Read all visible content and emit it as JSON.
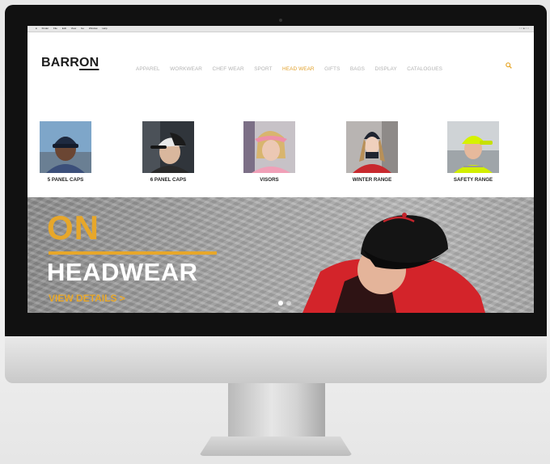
{
  "menubar": {
    "items": [
      "Finder",
      "File",
      "Edit",
      "View",
      "Go",
      "Window",
      "Help"
    ],
    "status": ""
  },
  "site": {
    "logo_part1": "BARR",
    "logo_part2": "ON",
    "nav": [
      {
        "label": "APPAREL",
        "active": false
      },
      {
        "label": "WORKWEAR",
        "active": false
      },
      {
        "label": "CHEF WEAR",
        "active": false
      },
      {
        "label": "SPORT",
        "active": false
      },
      {
        "label": "HEAD WEAR",
        "active": true
      },
      {
        "label": "GIFTS",
        "active": false
      },
      {
        "label": "BAGS",
        "active": false
      },
      {
        "label": "DISPLAY",
        "active": false
      },
      {
        "label": "CATALOGUES",
        "active": false
      }
    ]
  },
  "categories": [
    {
      "label": "5 PANEL CAPS"
    },
    {
      "label": "6 PANEL CAPS"
    },
    {
      "label": "VISORS"
    },
    {
      "label": "WINTER RANGE"
    },
    {
      "label": "SAFETY RANGE"
    }
  ],
  "hero": {
    "line1": "ON",
    "line2": "HEADWEAR",
    "cta": "VIEW DETAILS >",
    "slides": 2,
    "active_slide": 1
  },
  "colors": {
    "accent": "#e7a72a",
    "nav_inactive": "#b3b3b3",
    "dark_text": "#1d1d1d"
  },
  "icons": [
    "search-icon"
  ]
}
